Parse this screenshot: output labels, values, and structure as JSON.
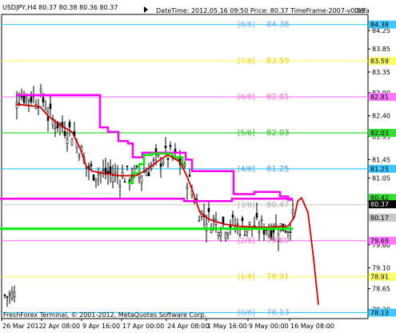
{
  "header": {
    "symbol_ohlc": "USDJPY,H4  80.37 80.38 80.36 80.37",
    "info": "DateTime: 2012.05.16 09:50    Price: 80.37    TimeFrame-2007-v0.05",
    "truncated": "Defa"
  },
  "footer": {
    "copyright": "FreshForex Terminal, © 2001-2012, MetaQuotes Software Corp."
  },
  "chart_data": {
    "type": "candlestick",
    "ylim": [
      78.0,
      84.6
    ],
    "y_ticks": [
      84.25,
      83.85,
      83.35,
      82.9,
      82.4,
      81.95,
      81.45,
      81.05,
      80.55,
      79.6,
      79.1,
      78.65,
      78.2
    ],
    "x_ticks": [
      "26 Mar 2012",
      "2 Apr 08:00",
      "9 Apr 16:00",
      "17 Apr 00:00",
      "24 Apr 08:00",
      "1 May 16:00",
      "9 May 00:00",
      "16 May 08:00"
    ],
    "murrey_levels": [
      {
        "label": "[8/8]",
        "value": 84.38,
        "color": "#3ec8ff"
      },
      {
        "label": "[7/8]",
        "value": 83.59,
        "color": "#ffff66"
      },
      {
        "label": "[6/8]",
        "value": 82.81,
        "color": "#ff77ff"
      },
      {
        "label": "[5/8]",
        "value": 82.03,
        "color": "#33dd33"
      },
      {
        "label": "[4/8]",
        "value": 81.25,
        "color": "#3ec8ff"
      },
      {
        "label": "[3/8]",
        "value": 80.47,
        "color": "#c8c8c8"
      },
      {
        "label": "[2/8]",
        "value": 79.69,
        "color": "#ff77ff"
      },
      {
        "label": "[1/8]",
        "value": 78.91,
        "color": "#ffff66"
      },
      {
        "label": "[0/8]",
        "value": 78.13,
        "color": "#3ec8ff"
      }
    ],
    "level_texts": [
      {
        "label": "[8/8]",
        "value": "84.38",
        "color": "#6aa8ff"
      },
      {
        "label": "[7/8]",
        "value": "83.59",
        "color": "#e6d000"
      },
      {
        "label": "[6/8]",
        "value": "82.81",
        "color": "#ff66cc"
      },
      {
        "label": "[5/8]",
        "value": "82.03",
        "color": "#22bb22"
      },
      {
        "label": "[4/8]",
        "value": "81.25",
        "color": "#3aa0ff"
      },
      {
        "label": "[3/8]",
        "value": "80.47",
        "color": "#aaaaaa"
      },
      {
        "label": "[2/8]",
        "value": "79.69",
        "color": "#ff66cc"
      },
      {
        "label": "[1/8]",
        "value": "78.91",
        "color": "#e6d000"
      },
      {
        "label": "[0/8]",
        "value": "78.13",
        "color": "#6aa8ff"
      }
    ],
    "price_labels": [
      {
        "text": "84.38",
        "value": 84.38,
        "bg": "#3ec8ff"
      },
      {
        "text": "83.59",
        "value": 83.59,
        "bg": "#ffff66"
      },
      {
        "text": "82.81",
        "value": 82.81,
        "bg": "#ff77ff"
      },
      {
        "text": "82.03",
        "value": 82.03,
        "bg": "#33dd33"
      },
      {
        "text": "81.25",
        "value": 81.25,
        "bg": "#3ec8ff"
      },
      {
        "text": "80.42",
        "value": 80.62,
        "bg": "#33dd33"
      },
      {
        "text": "80.37",
        "value": 80.48,
        "bg": "#000000"
      },
      {
        "text": "80.17",
        "value": 80.19,
        "bg": "#c8c8c8"
      },
      {
        "text": "79.69",
        "value": 79.69,
        "bg": "#ff77ff"
      },
      {
        "text": "78.91",
        "value": 78.91,
        "bg": "#ffff66"
      },
      {
        "text": "78.13",
        "value": 78.13,
        "bg": "#3ec8ff"
      }
    ],
    "series": [
      {
        "name": "magenta-band",
        "color": "#ff00ff",
        "points": [
          [
            20,
            82.85
          ],
          [
            125,
            82.85
          ],
          [
            125,
            82.15
          ],
          [
            135,
            82.15
          ],
          [
            135,
            82.05
          ],
          [
            148,
            82.05
          ],
          [
            148,
            81.85
          ],
          [
            160,
            81.85
          ],
          [
            160,
            81.8
          ],
          [
            166,
            81.8
          ],
          [
            166,
            81.5
          ],
          [
            178,
            81.5
          ],
          [
            178,
            81.6
          ],
          [
            232,
            81.6
          ],
          [
            232,
            81.45
          ],
          [
            240,
            81.45
          ],
          [
            240,
            81.2
          ],
          [
            292,
            81.2
          ],
          [
            292,
            80.7
          ],
          [
            318,
            80.7
          ],
          [
            318,
            80.75
          ],
          [
            350,
            80.75
          ],
          [
            350,
            80.65
          ],
          [
            360,
            80.65
          ],
          [
            360,
            80.58
          ],
          [
            366,
            80.58
          ]
        ]
      },
      {
        "name": "green-band",
        "color": "#00ee00",
        "points": [
          [
            160,
            80.95
          ],
          [
            166,
            80.95
          ],
          [
            166,
            81.15
          ],
          [
            174,
            81.15
          ],
          [
            174,
            81.35
          ],
          [
            180,
            81.35
          ],
          [
            180,
            81.55
          ],
          [
            190,
            81.55
          ],
          [
            190,
            81.58
          ],
          [
            215,
            81.58
          ],
          [
            215,
            81.5
          ],
          [
            228,
            81.5
          ],
          [
            228,
            81.25
          ]
        ]
      },
      {
        "name": "red-line",
        "color": "#d40000",
        "points": [
          [
            20,
            82.65
          ],
          [
            50,
            82.6
          ],
          [
            60,
            82.4
          ],
          [
            75,
            82.2
          ],
          [
            90,
            82.05
          ],
          [
            100,
            81.7
          ],
          [
            108,
            81.3
          ],
          [
            115,
            81.2
          ],
          [
            130,
            81.15
          ],
          [
            150,
            81.1
          ],
          [
            170,
            81.1
          ],
          [
            185,
            81.25
          ],
          [
            200,
            81.45
          ],
          [
            210,
            81.55
          ],
          [
            225,
            81.4
          ],
          [
            232,
            81.15
          ],
          [
            238,
            80.9
          ],
          [
            244,
            80.6
          ],
          [
            250,
            80.3
          ],
          [
            262,
            80.15
          ],
          [
            280,
            80.05
          ],
          [
            300,
            80.0
          ],
          [
            330,
            79.98
          ],
          [
            360,
            80.0
          ],
          [
            368,
            80.2
          ],
          [
            372,
            80.55
          ],
          [
            377,
            80.62
          ],
          [
            385,
            80.3
          ],
          [
            392,
            79.3
          ],
          [
            398,
            78.3
          ]
        ]
      },
      {
        "name": "support-green",
        "color": "#00ee00",
        "points": [
          [
            0,
            79.95
          ],
          [
            366,
            79.95
          ]
        ]
      },
      {
        "name": "resistance-magenta",
        "color": "#ff00ff",
        "points": [
          [
            0,
            80.6
          ],
          [
            230,
            80.6
          ],
          [
            230,
            80.55
          ],
          [
            290,
            80.55
          ],
          [
            290,
            80.6
          ],
          [
            366,
            80.6
          ]
        ]
      }
    ]
  }
}
